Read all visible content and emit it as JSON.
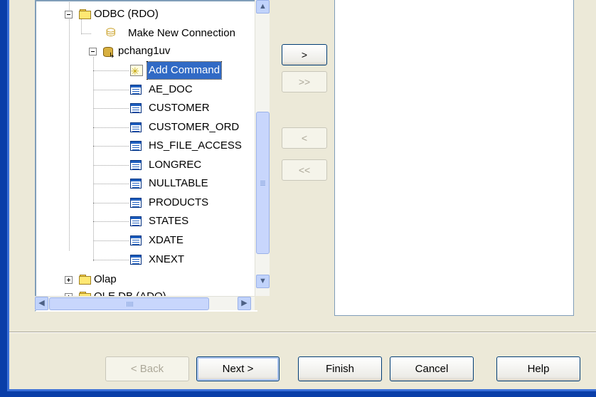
{
  "tree": {
    "nodes": [
      {
        "label": "ODBC (RDO)",
        "icon": "folder-icon",
        "expander": "minus"
      },
      {
        "label": "Make New Connection",
        "icon": "new-connection-icon"
      },
      {
        "label": "pchang1uv",
        "icon": "database-icon",
        "expander": "minus"
      },
      {
        "label": "Add Command",
        "icon": "add-command-icon",
        "selected": true
      },
      {
        "label": "AE_DOC",
        "icon": "table-icon"
      },
      {
        "label": "CUSTOMER",
        "icon": "table-icon"
      },
      {
        "label": "CUSTOMER_ORD",
        "icon": "table-icon"
      },
      {
        "label": "HS_FILE_ACCESS",
        "icon": "table-icon"
      },
      {
        "label": "LONGREC",
        "icon": "table-icon"
      },
      {
        "label": "NULLTABLE",
        "icon": "table-icon"
      },
      {
        "label": "PRODUCTS",
        "icon": "table-icon"
      },
      {
        "label": "STATES",
        "icon": "table-icon"
      },
      {
        "label": "XDATE",
        "icon": "table-icon"
      },
      {
        "label": "XNEXT",
        "icon": "table-icon"
      },
      {
        "label": "Olap",
        "icon": "folder-icon",
        "expander": "plus"
      },
      {
        "label": "OLE DB (ADO)",
        "icon": "folder-icon",
        "expander": "plus"
      }
    ]
  },
  "move_buttons": {
    "add_one": ">",
    "add_all": ">>",
    "remove_one": "<",
    "remove_all": "<<"
  },
  "dialog_buttons": {
    "back": "< Back",
    "next": "Next >",
    "finish": "Finish",
    "cancel": "Cancel",
    "help": "Help"
  },
  "colors": {
    "selection": "#316ac5",
    "window_frame": "#0a3ea8",
    "dialog_background": "#ece9d8"
  }
}
